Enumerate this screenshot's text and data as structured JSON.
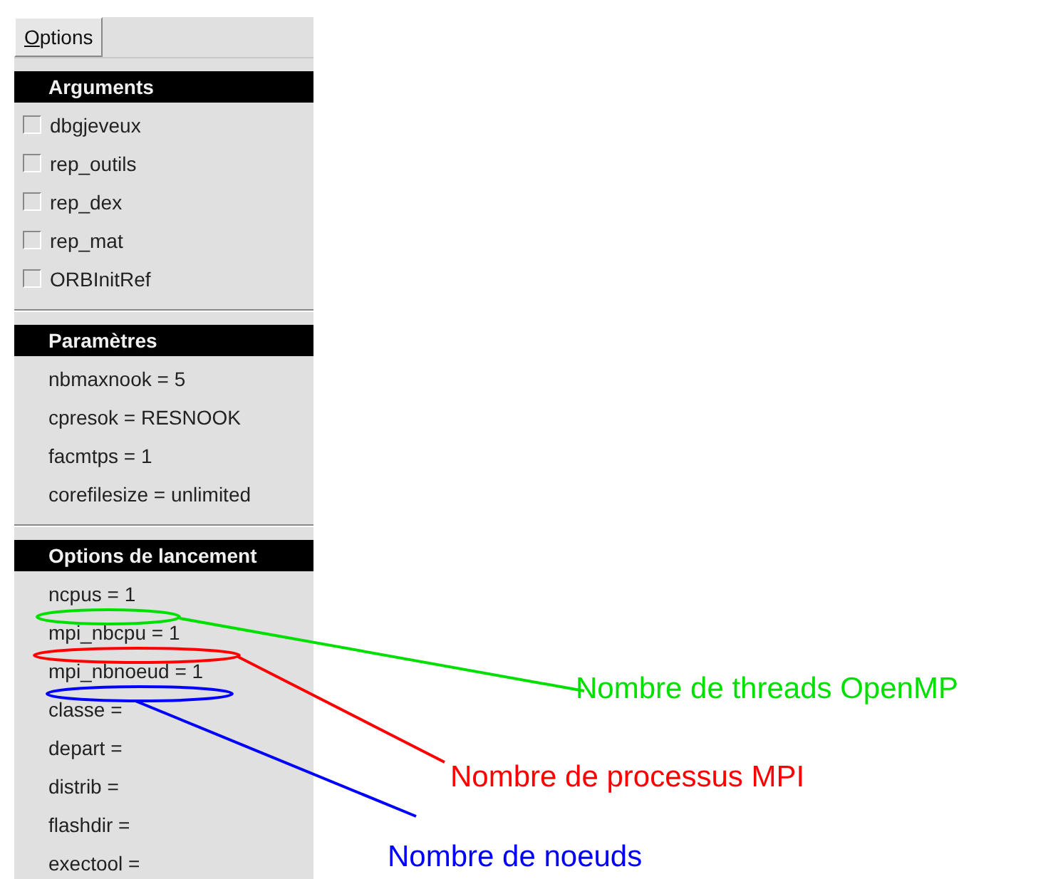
{
  "menu_button": {
    "label": "Options"
  },
  "sections": [
    {
      "title": "Arguments",
      "kind": "checkbox",
      "items": [
        {
          "label": "dbgjeveux",
          "checked": false
        },
        {
          "label": "rep_outils",
          "checked": false
        },
        {
          "label": "rep_dex",
          "checked": false
        },
        {
          "label": "rep_mat",
          "checked": false
        },
        {
          "label": "ORBInitRef",
          "checked": false
        }
      ]
    },
    {
      "title": "Paramètres",
      "kind": "param",
      "items": [
        {
          "label": "nbmaxnook = 5"
        },
        {
          "label": "cpresok = RESNOOK"
        },
        {
          "label": "facmtps = 1"
        },
        {
          "label": "corefilesize = unlimited"
        }
      ]
    },
    {
      "title": "Options de lancement",
      "kind": "param",
      "items": [
        {
          "label": "ncpus = 1"
        },
        {
          "label": "mpi_nbcpu = 1"
        },
        {
          "label": "mpi_nbnoeud = 1"
        },
        {
          "label": "classe ="
        },
        {
          "label": "depart ="
        },
        {
          "label": "distrib ="
        },
        {
          "label": "flashdir ="
        },
        {
          "label": "exectool ="
        }
      ]
    }
  ],
  "annotations": [
    {
      "text": "Nombre de threads OpenMP",
      "color": "#00e000"
    },
    {
      "text": "Nombre de processus MPI",
      "color": "#ff0000"
    },
    {
      "text": "Nombre de noeuds",
      "color": "#0000ff"
    }
  ]
}
